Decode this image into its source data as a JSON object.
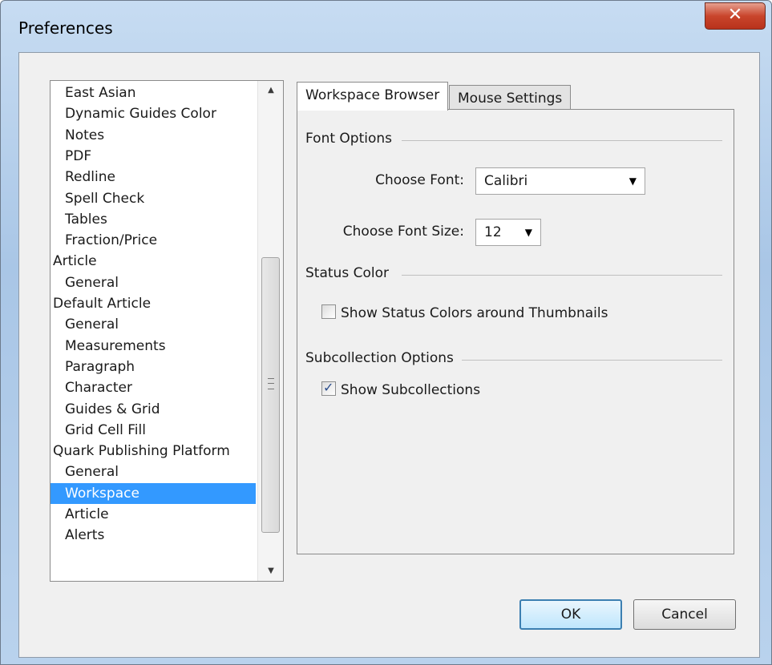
{
  "window": {
    "title": "Preferences",
    "close_glyph": "✕"
  },
  "tree": {
    "items": [
      {
        "label": "East Asian",
        "level": 1
      },
      {
        "label": "Dynamic Guides Color",
        "level": 1
      },
      {
        "label": "Notes",
        "level": 1
      },
      {
        "label": "PDF",
        "level": 1
      },
      {
        "label": "Redline",
        "level": 1
      },
      {
        "label": "Spell Check",
        "level": 1
      },
      {
        "label": "Tables",
        "level": 1
      },
      {
        "label": "Fraction/Price",
        "level": 1
      },
      {
        "label": "Article",
        "level": 0
      },
      {
        "label": "General",
        "level": 1
      },
      {
        "label": "Default Article",
        "level": 0
      },
      {
        "label": "General",
        "level": 1
      },
      {
        "label": "Measurements",
        "level": 1
      },
      {
        "label": "Paragraph",
        "level": 1
      },
      {
        "label": "Character",
        "level": 1
      },
      {
        "label": "Guides & Grid",
        "level": 1
      },
      {
        "label": "Grid Cell Fill",
        "level": 1
      },
      {
        "label": "Quark Publishing Platform",
        "level": 0
      },
      {
        "label": "General",
        "level": 1
      },
      {
        "label": "Workspace",
        "level": 1,
        "selected": true
      },
      {
        "label": "Article",
        "level": 1
      },
      {
        "label": "Alerts",
        "level": 1
      }
    ],
    "scroll_up_glyph": "▲",
    "scroll_down_glyph": "▼"
  },
  "tabs": [
    {
      "label": "Workspace Browser",
      "active": true
    },
    {
      "label": "Mouse Settings",
      "active": false
    }
  ],
  "font_options": {
    "group_label": "Font Options",
    "font_label": "Choose Font:",
    "font_value": "Calibri",
    "size_label": "Choose Font Size:",
    "size_value": "12",
    "dropdown_glyph": "▼"
  },
  "status_color": {
    "group_label": "Status Color",
    "checkbox_label": "Show Status Colors around Thumbnails",
    "checked": false
  },
  "subcollection": {
    "group_label": "Subcollection Options",
    "checkbox_label": "Show Subcollections",
    "checked": true
  },
  "buttons": {
    "ok": "OK",
    "cancel": "Cancel"
  },
  "colors": {
    "selection": "#3399ff",
    "close_button": "#c9452c",
    "title_bar": "#b9d2ed"
  }
}
